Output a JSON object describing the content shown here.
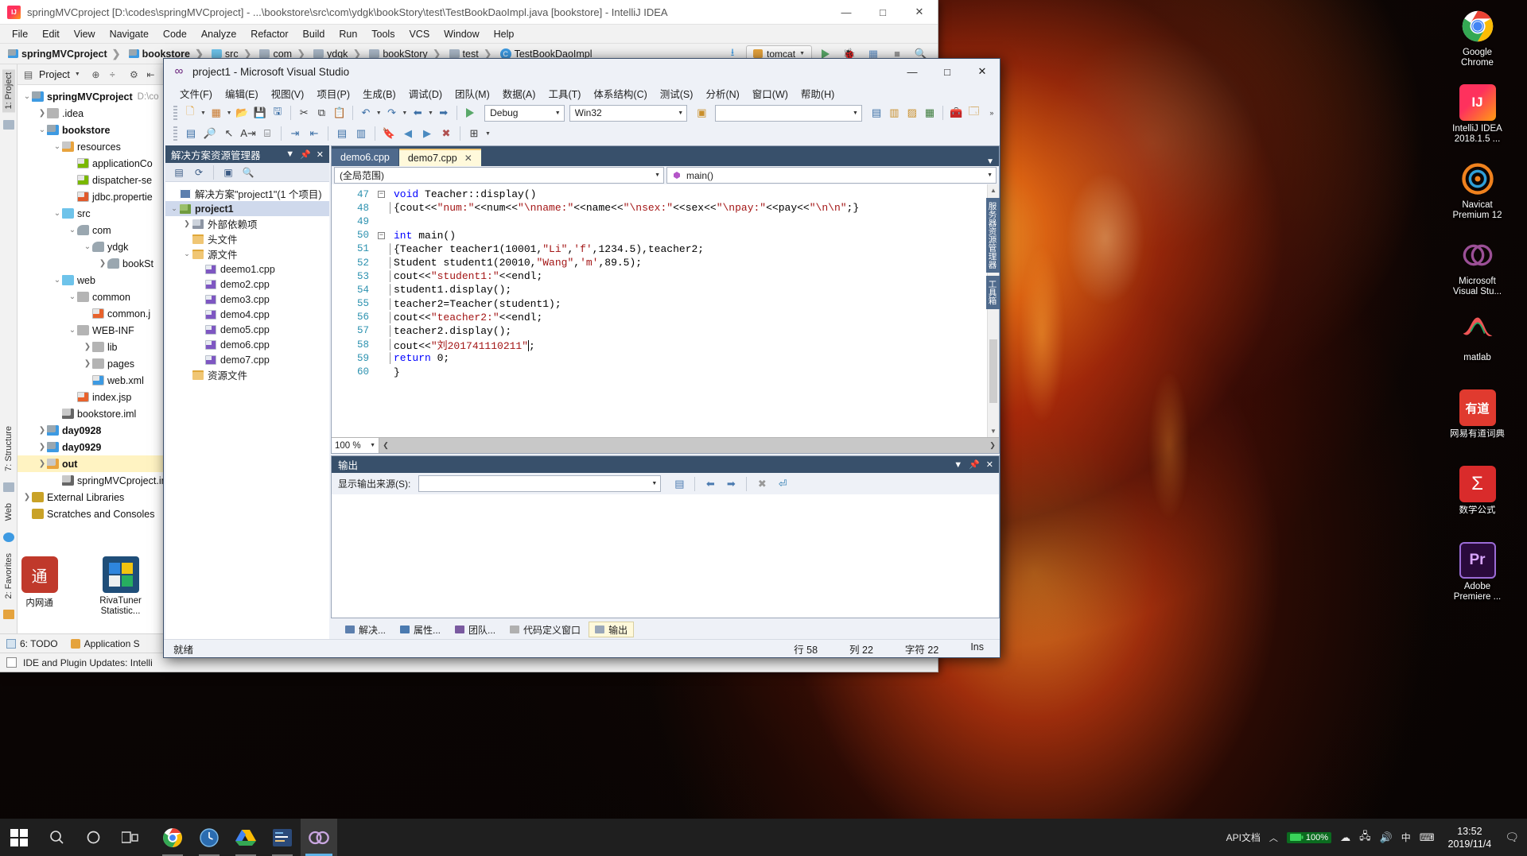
{
  "desktop": {
    "icons": [
      {
        "label": "Google\nChrome",
        "icon": "chrome-icon"
      },
      {
        "label": "IntelliJ IDEA\n2018.1.5 ...",
        "icon": "intellij-idea-icon"
      },
      {
        "label": "Navicat\nPremium 12",
        "icon": "navicat-icon"
      },
      {
        "label": "Microsoft\nVisual Stu...",
        "icon": "visual-studio-icon"
      },
      {
        "label": "matlab",
        "icon": "matlab-icon"
      },
      {
        "label": "网易有道词典",
        "icon": "youdao-dict-icon"
      },
      {
        "label": "数学公式",
        "icon": "lenovo-math-icon"
      },
      {
        "label": "Adobe\nPremiere ...",
        "icon": "adobe-premiere-icon"
      }
    ]
  },
  "intellij": {
    "title": "springMVCproject [D:\\codes\\springMVCproject] - ...\\bookstore\\src\\com\\ydgk\\bookStory\\test\\TestBookDaoImpl.java [bookstore] - IntelliJ IDEA",
    "window_buttons": {
      "minimize": "—",
      "maximize": "□",
      "close": "✕"
    },
    "menu": [
      "File",
      "Edit",
      "View",
      "Navigate",
      "Code",
      "Analyze",
      "Refactor",
      "Build",
      "Run",
      "Tools",
      "VCS",
      "Window",
      "Help"
    ],
    "breadcrumb": [
      "springMVCproject",
      "bookstore",
      "src",
      "com",
      "ydgk",
      "bookStory",
      "test",
      "TestBookDaoImpl"
    ],
    "run_config": "tomcat",
    "left_tabs": [
      "1: Project",
      "7: Structure",
      "Web",
      "2: Favorites"
    ],
    "project_panel": {
      "title": "Project",
      "tree": [
        {
          "depth": 0,
          "twisty": "v",
          "label": "springMVCproject",
          "bold": true,
          "icon": "module-icon",
          "path": "D:\\co"
        },
        {
          "depth": 1,
          "twisty": ">",
          "label": ".idea",
          "bold": false,
          "icon": "folder-icon",
          "path": ""
        },
        {
          "depth": 1,
          "twisty": "v",
          "label": "bookstore",
          "bold": true,
          "icon": "module-icon",
          "path": ""
        },
        {
          "depth": 2,
          "twisty": "v",
          "label": "resources",
          "bold": false,
          "icon": "resource-folder-icon",
          "path": ""
        },
        {
          "depth": 3,
          "twisty": "",
          "label": "applicationCo",
          "bold": false,
          "icon": "xml-file-icon",
          "path": ""
        },
        {
          "depth": 3,
          "twisty": "",
          "label": "dispatcher-se",
          "bold": false,
          "icon": "xml-file-icon",
          "path": ""
        },
        {
          "depth": 3,
          "twisty": "",
          "label": "jdbc.propertie",
          "bold": false,
          "icon": "properties-file-icon",
          "path": ""
        },
        {
          "depth": 2,
          "twisty": "v",
          "label": "src",
          "bold": false,
          "icon": "source-folder-icon",
          "path": ""
        },
        {
          "depth": 3,
          "twisty": "v",
          "label": "com",
          "bold": false,
          "icon": "package-icon",
          "path": ""
        },
        {
          "depth": 4,
          "twisty": "v",
          "label": "ydgk",
          "bold": false,
          "icon": "package-icon",
          "path": ""
        },
        {
          "depth": 5,
          "twisty": ">",
          "label": "bookSt",
          "bold": false,
          "icon": "package-icon",
          "path": ""
        },
        {
          "depth": 2,
          "twisty": "v",
          "label": "web",
          "bold": false,
          "icon": "web-folder-icon",
          "path": ""
        },
        {
          "depth": 3,
          "twisty": "v",
          "label": "common",
          "bold": false,
          "icon": "folder-icon",
          "path": ""
        },
        {
          "depth": 4,
          "twisty": "",
          "label": "common.j",
          "bold": false,
          "icon": "jsp-file-icon",
          "path": ""
        },
        {
          "depth": 3,
          "twisty": "v",
          "label": "WEB-INF",
          "bold": false,
          "icon": "folder-icon",
          "path": ""
        },
        {
          "depth": 4,
          "twisty": ">",
          "label": "lib",
          "bold": false,
          "icon": "folder-icon",
          "path": ""
        },
        {
          "depth": 4,
          "twisty": ">",
          "label": "pages",
          "bold": false,
          "icon": "folder-icon",
          "path": ""
        },
        {
          "depth": 4,
          "twisty": "",
          "label": "web.xml",
          "bold": false,
          "icon": "xml-web-file-icon",
          "path": ""
        },
        {
          "depth": 3,
          "twisty": "",
          "label": "index.jsp",
          "bold": false,
          "icon": "jsp-file-icon",
          "path": ""
        },
        {
          "depth": 2,
          "twisty": "",
          "label": "bookstore.iml",
          "bold": false,
          "icon": "iml-file-icon",
          "path": ""
        },
        {
          "depth": 1,
          "twisty": ">",
          "label": "day0928",
          "bold": true,
          "icon": "module-icon",
          "path": ""
        },
        {
          "depth": 1,
          "twisty": ">",
          "label": "day0929",
          "bold": true,
          "icon": "module-icon",
          "path": ""
        },
        {
          "depth": 1,
          "twisty": ">",
          "label": "out",
          "bold": true,
          "icon": "folder-orange-icon",
          "path": "",
          "selected": true
        },
        {
          "depth": 2,
          "twisty": "",
          "label": "springMVCproject.im",
          "bold": false,
          "icon": "iml-file-icon",
          "path": ""
        },
        {
          "depth": 0,
          "twisty": ">",
          "label": "External Libraries",
          "bold": false,
          "icon": "library-icon",
          "path": ""
        },
        {
          "depth": 0,
          "twisty": "",
          "label": "Scratches and Consoles",
          "bold": false,
          "icon": "scratches-icon",
          "path": ""
        }
      ]
    },
    "bottom_tabs": [
      {
        "label": "6: TODO",
        "icon": "todo-icon"
      },
      {
        "label": "Application S",
        "icon": "application-servers-icon"
      }
    ],
    "status_bar": "IDE and Plugin Updates: Intelli"
  },
  "visual_studio": {
    "title": "project1 - Microsoft Visual Studio",
    "window_buttons": {
      "minimize": "—",
      "maximize": "□",
      "close": "✕"
    },
    "menu": [
      "文件(F)",
      "编辑(E)",
      "视图(V)",
      "项目(P)",
      "生成(B)",
      "调试(D)",
      "团队(M)",
      "数据(A)",
      "工具(T)",
      "体系结构(C)",
      "测试(S)",
      "分析(N)",
      "窗口(W)",
      "帮助(H)"
    ],
    "toolbar": {
      "config": "Debug",
      "platform": "Win32",
      "search_value": "",
      "start_label": "▶"
    },
    "solution_explorer": {
      "title": "解决方案资源管理器",
      "tree": [
        {
          "depth": 0,
          "twisty": "",
          "label": "解决方案\"project1\"(1 个项目)",
          "icon": "solution-icon",
          "bold": false
        },
        {
          "depth": 0,
          "twisty": "v",
          "label": "project1",
          "icon": "project-icon",
          "bold": true,
          "selected": true
        },
        {
          "depth": 1,
          "twisty": ">",
          "label": "外部依赖项",
          "icon": "external-dependencies-icon",
          "bold": false
        },
        {
          "depth": 1,
          "twisty": "",
          "label": "头文件",
          "icon": "folder-icon",
          "bold": false
        },
        {
          "depth": 1,
          "twisty": "v",
          "label": "源文件",
          "icon": "folder-icon",
          "bold": false
        },
        {
          "depth": 2,
          "twisty": "",
          "label": "deemo1.cpp",
          "icon": "cpp-file-icon",
          "bold": false
        },
        {
          "depth": 2,
          "twisty": "",
          "label": "demo2.cpp",
          "icon": "cpp-file-icon",
          "bold": false
        },
        {
          "depth": 2,
          "twisty": "",
          "label": "demo3.cpp",
          "icon": "cpp-file-icon",
          "bold": false
        },
        {
          "depth": 2,
          "twisty": "",
          "label": "demo4.cpp",
          "icon": "cpp-file-icon",
          "bold": false
        },
        {
          "depth": 2,
          "twisty": "",
          "label": "demo5.cpp",
          "icon": "cpp-file-icon",
          "bold": false
        },
        {
          "depth": 2,
          "twisty": "",
          "label": "demo6.cpp",
          "icon": "cpp-file-icon",
          "bold": false
        },
        {
          "depth": 2,
          "twisty": "",
          "label": "demo7.cpp",
          "icon": "cpp-file-icon",
          "bold": false
        },
        {
          "depth": 1,
          "twisty": "",
          "label": "资源文件",
          "icon": "folder-icon",
          "bold": false
        }
      ]
    },
    "editor": {
      "tabs": [
        {
          "label": "demo6.cpp",
          "active": false,
          "closable": false
        },
        {
          "label": "demo7.cpp",
          "active": true,
          "closable": true
        }
      ],
      "scope_combo": "(全局范围)",
      "member_combo": "main()",
      "zoom": "100 %",
      "lines": [
        {
          "num": "47",
          "fold": "-",
          "bar": false,
          "tokens": [
            {
              "t": "void ",
              "c": "kw"
            },
            {
              "t": "Teacher::display()",
              "c": "txt"
            }
          ]
        },
        {
          "num": "48",
          "fold": "",
          "bar": true,
          "tokens": [
            {
              "t": "{cout<<",
              "c": "txt"
            },
            {
              "t": "\"num:\"",
              "c": "str"
            },
            {
              "t": "<<num<<",
              "c": "txt"
            },
            {
              "t": "\"\\nname:\"",
              "c": "str"
            },
            {
              "t": "<<name<<",
              "c": "txt"
            },
            {
              "t": "\"\\nsex:\"",
              "c": "str"
            },
            {
              "t": "<<sex<<",
              "c": "txt"
            },
            {
              "t": "\"\\npay:\"",
              "c": "str"
            },
            {
              "t": "<<pay<<",
              "c": "txt"
            },
            {
              "t": "\"\\n\\n\"",
              "c": "str"
            },
            {
              "t": ";}",
              "c": "txt"
            }
          ]
        },
        {
          "num": "49",
          "fold": "",
          "bar": false,
          "tokens": []
        },
        {
          "num": "50",
          "fold": "-",
          "bar": false,
          "tokens": [
            {
              "t": "int ",
              "c": "kw"
            },
            {
              "t": "main()",
              "c": "txt"
            }
          ]
        },
        {
          "num": "51",
          "fold": "",
          "bar": true,
          "tokens": [
            {
              "t": "{Teacher teacher1(10001,",
              "c": "txt"
            },
            {
              "t": "\"Li\"",
              "c": "str"
            },
            {
              "t": ",",
              "c": "txt"
            },
            {
              "t": "'f'",
              "c": "str"
            },
            {
              "t": ",1234.5),teacher2;",
              "c": "txt"
            }
          ]
        },
        {
          "num": "52",
          "fold": "",
          "bar": true,
          "tokens": [
            {
              "t": "Student student1(20010,",
              "c": "txt"
            },
            {
              "t": "\"Wang\"",
              "c": "str"
            },
            {
              "t": ",",
              "c": "txt"
            },
            {
              "t": "'m'",
              "c": "str"
            },
            {
              "t": ",89.5);",
              "c": "txt"
            }
          ]
        },
        {
          "num": "53",
          "fold": "",
          "bar": true,
          "tokens": [
            {
              "t": "cout<<",
              "c": "txt"
            },
            {
              "t": "\"student1:\"",
              "c": "str"
            },
            {
              "t": "<<endl;",
              "c": "txt"
            }
          ]
        },
        {
          "num": "54",
          "fold": "",
          "bar": true,
          "tokens": [
            {
              "t": "student1.display();",
              "c": "txt"
            }
          ]
        },
        {
          "num": "55",
          "fold": "",
          "bar": true,
          "tokens": [
            {
              "t": "teacher2=Teacher(student1);",
              "c": "txt"
            }
          ]
        },
        {
          "num": "56",
          "fold": "",
          "bar": true,
          "tokens": [
            {
              "t": "cout<<",
              "c": "txt"
            },
            {
              "t": "\"teacher2:\"",
              "c": "str"
            },
            {
              "t": "<<endl;",
              "c": "txt"
            }
          ]
        },
        {
          "num": "57",
          "fold": "",
          "bar": true,
          "tokens": [
            {
              "t": "teacher2.display();",
              "c": "txt"
            }
          ]
        },
        {
          "num": "58",
          "fold": "",
          "bar": true,
          "tokens": [
            {
              "t": "cout<<",
              "c": "txt"
            },
            {
              "t": "\"刘201741110211\"",
              "c": "str"
            },
            {
              "t": ";",
              "c": "txt"
            }
          ]
        },
        {
          "num": "59",
          "fold": "",
          "bar": true,
          "tokens": [
            {
              "t": "return ",
              "c": "kw"
            },
            {
              "t": "0;",
              "c": "txt"
            }
          ]
        },
        {
          "num": "60",
          "fold": "",
          "bar": false,
          "tokens": [
            {
              "t": "}",
              "c": "txt"
            }
          ]
        }
      ]
    },
    "output_panel": {
      "title": "输出",
      "source_label": "显示输出来源(S):",
      "source_value": ""
    },
    "doc_tabs": [
      {
        "label": "解决...",
        "active": false
      },
      {
        "label": "属性...",
        "active": false
      },
      {
        "label": "团队...",
        "active": false
      },
      {
        "label": "代码定义窗口",
        "active": false
      },
      {
        "label": "输出",
        "active": true
      }
    ],
    "right_tabs": [
      "服务器资源管理器",
      "工具箱"
    ],
    "status": {
      "ready": "就绪",
      "line": "行 58",
      "column": "列 22",
      "char": "字符 22",
      "insert": "Ins"
    }
  },
  "taskbar": {
    "start": "start-icon",
    "search": "search-icon",
    "cortana": "cortana-icon",
    "taskview": "task-view-icon",
    "apps": [
      {
        "name": "chrome-taskbar-icon",
        "open": true
      },
      {
        "name": "clock-taskbar-icon",
        "open": true
      },
      {
        "name": "drive-taskbar-icon",
        "open": true
      },
      {
        "name": "editor-taskbar-icon",
        "open": true
      },
      {
        "name": "visual-studio-taskbar-icon",
        "open": true,
        "active": true
      }
    ],
    "tray": {
      "api_label": "API文档",
      "battery": "100%",
      "ime": "中",
      "time": "13:52",
      "date": "2019/11/4"
    }
  },
  "desktop_left_icons": [
    {
      "label": "内网通",
      "icon": "neiwangtong-icon"
    },
    {
      "label": "RivaTuner\nStatistic...",
      "icon": "rivatuner-icon"
    }
  ]
}
